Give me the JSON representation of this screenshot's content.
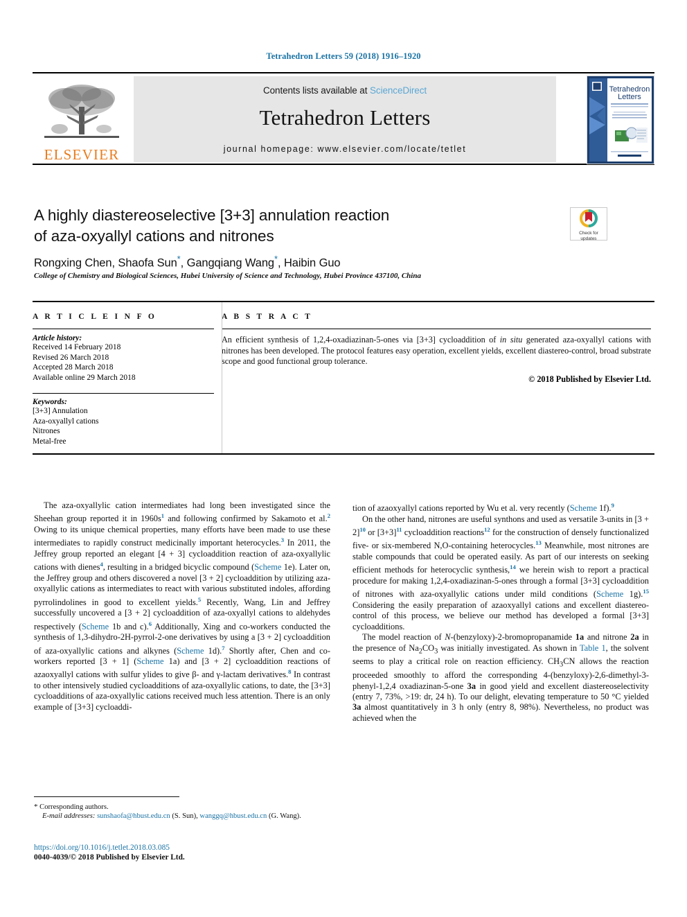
{
  "running_head": "Tetrahedron Letters 59 (2018) 1916–1920",
  "masthead": {
    "contents_prefix": "Contents lists available at ",
    "sciencedirect": "ScienceDirect",
    "journal_name": "Tetrahedron Letters",
    "homepage": "journal homepage: www.elsevier.com/locate/tetlet",
    "publisher_wordmark": "ELSEVIER",
    "cover_title_line1": "Tetrahedron",
    "cover_title_line2": "Letters"
  },
  "article": {
    "title_line1": "A highly diastereoselective [3+3] annulation reaction",
    "title_line2": "of aza-oxyallyl cations and nitrones",
    "authors": "Rongxing Chen, Shaofa Sun , Gangqiang Wang , Haibin Guo",
    "author_1": "Rongxing Chen, Shaofa Sun",
    "author_2": ", Gangqiang Wang",
    "author_3": ", Haibin Guo",
    "affiliation": "College of Chemistry and Biological Sciences, Hubei University of Science and Technology, Hubei Province 437100, China"
  },
  "crossmark": {
    "label_line1": "Check for",
    "label_line2": "updates"
  },
  "info": {
    "heading": "A R T I C L E   I N F O",
    "history_label": "Article history:",
    "history": [
      "Received 14 February 2018",
      "Revised 26 March 2018",
      "Accepted 28 March 2018",
      "Available online 29 March 2018"
    ],
    "keywords_label": "Keywords:",
    "keywords": [
      "[3+3] Annulation",
      "Aza-oxyallyl cations",
      "Nitrones",
      "Metal-free"
    ]
  },
  "abstract": {
    "heading": "A B S T R A C T",
    "text_part1": "An efficient synthesis of 1,2,4-oxadiazinan-5-ones via [3+3] cycloaddition of ",
    "in_situ": "in situ",
    "text_part2": " generated aza-oxyallyl cations with nitrones has been developed. The protocol features easy operation, excellent yields, excellent diastereo-control, broad substrate scope and good functional group tolerance.",
    "copyright": "© 2018 Published by Elsevier Ltd."
  },
  "body": {
    "left_p1_a": "The aza-oxyallylic cation intermediates had long been investigated since the Sheehan group reported it in 1960s",
    "left_p1_r1": "1",
    "left_p1_b": " and following confirmed by Sakamoto et al.",
    "left_p1_r2": "2",
    "left_p1_c": " Owing to its unique chemical properties, many efforts have been made to use these intermediates to rapidly construct medicinally important heterocycles.",
    "left_p1_r3": "3",
    "left_p1_d": " In 2011, the Jeffrey group reported an elegant [4 + 3] cycloaddition reaction of aza-oxyallylic cations with dienes",
    "left_p1_r4": "4",
    "left_p1_e": ", resulting in a bridged bicyclic compound (",
    "left_p1_scheme1": "Scheme",
    "left_p1_f": " 1e). Later on, the Jeffrey group and others discovered a novel [3 + 2] cycloaddition by utilizing aza-oxyallylic cations as intermediates to react with various substituted indoles, affording pyrrolindolines in good to excellent yields.",
    "left_p1_r5": "5",
    "left_p1_g": " Recently, Wang, Lin and Jeffrey successfully uncovered a [3 + 2] cycloaddition of aza-oxyallyl cations to aldehydes respectively (",
    "left_p1_scheme2": "Scheme",
    "left_p1_h": " 1b and c).",
    "left_p1_r6": "6",
    "left_p1_i": " Additionally, Xing and co-workers conducted the synthesis of 1,3-dihydro-2H-pyrrol-2-one derivatives by using a [3 + 2] cycloaddition of aza-oxyallylic cations and alkynes (",
    "left_p1_scheme3": "Scheme",
    "left_p1_j": " 1d).",
    "left_p1_r7": "7",
    "left_p1_k": " Shortly after, Chen and co-workers reported [3 + 1] (",
    "left_p1_scheme4": "Scheme",
    "left_p1_l": " 1a) and [3 + 2] cycloaddition reactions of azaoxyallyl cations with sulfur ylides to give β- and γ-lactam derivatives.",
    "left_p1_r8": "8",
    "left_p1_m": " In contrast to other intensively studied cycloadditions of aza-oxyallylic cations, to date, the [3+3] cycloadditions of aza-oxyallylic cations received much less attention. There is an only example of [3+3] cycloaddi-",
    "right_p1_a": "tion of azaoxyallyl cations reported by Wu et al. very recently (",
    "right_p1_scheme": "Scheme",
    "right_p1_b": " 1f).",
    "right_p1_r9": "9",
    "right_p2_a": "On the other hand, nitrones are useful synthons and used as versatile 3-units in [3 + 2]",
    "right_p2_r10": "10",
    "right_p2_b": " or [3+3]",
    "right_p2_r11": "11",
    "right_p2_c": " cycloaddition reactions",
    "right_p2_r12": "12",
    "right_p2_d": " for the construction of densely functionalized five- or six-membered N,O-containing heterocycles.",
    "right_p2_r13": "13",
    "right_p2_e": " Meanwhile, most nitrones are stable compounds that could be operated easily. As part of our interests on seeking efficient methods for heterocyclic synthesis,",
    "right_p2_r14": "14",
    "right_p2_f": " we herein wish to report a practical procedure for making 1,2,4-oxadiazinan-5-ones through a formal [3+3] cycloaddition of nitrones with aza-oxyallylic cations under mild conditions (",
    "right_p2_scheme": "Scheme",
    "right_p2_g": " 1g).",
    "right_p2_r15": "15",
    "right_p2_h": " Considering the easily preparation of azaoxyallyl cations and excellent diastereo-control of this process, we believe our method has developed a formal [3+3] cycloadditions.",
    "right_p3_a": "The model reaction of ",
    "right_p3_N": "N",
    "right_p3_b": "-(benzyloxy)-2-bromopropanamide ",
    "right_p3_c1": "1a",
    "right_p3_c": " and nitrone ",
    "right_p3_c2": "2a",
    "right_p3_d": " in the presence of Na",
    "right_p3_sub1": "2",
    "right_p3_e": "CO",
    "right_p3_sub2": "3",
    "right_p3_f": " was initially investigated. As shown in ",
    "right_p3_table": "Table 1",
    "right_p3_g": ", the solvent seems to play a critical role on reaction efficiency. CH",
    "right_p3_sub3": "3",
    "right_p3_h": "CN allows the reaction proceeded smoothly to afford the corresponding 4-(benzyloxy)-2,6-dimethyl-3-phenyl-1,2,4 oxadiazinan-5-one ",
    "right_p3_c3": "3a",
    "right_p3_i": " in good yield and excellent diastereoselectivity (entry 7, 73%, >19: dr, 24 h). To our delight, elevating temperature to 50 °C yielded ",
    "right_p3_c4": "3a",
    "right_p3_j": " almost quantitatively in 3 h only (entry 8, 98%). Nevertheless, no product was achieved when the"
  },
  "footer": {
    "corresponding": "Corresponding authors.",
    "email_label": "E-mail addresses:",
    "email_1": "sunshaofa@hbust.edu.cn",
    "email_1_name": " (S. Sun), ",
    "email_2": "wanggq@hbust.edu.cn",
    "email_2_name": "(G. Wang).",
    "doi": "https://doi.org/10.1016/j.tetlet.2018.03.085",
    "issn_line": "0040-4039/© 2018 Published by Elsevier Ltd."
  },
  "colors": {
    "link_blue": "#1a72a4",
    "elsevier_orange": "#e87d1e",
    "masthead_gray": "#e6e6e6",
    "sciencedirect_blue": "#5ba7d4"
  }
}
